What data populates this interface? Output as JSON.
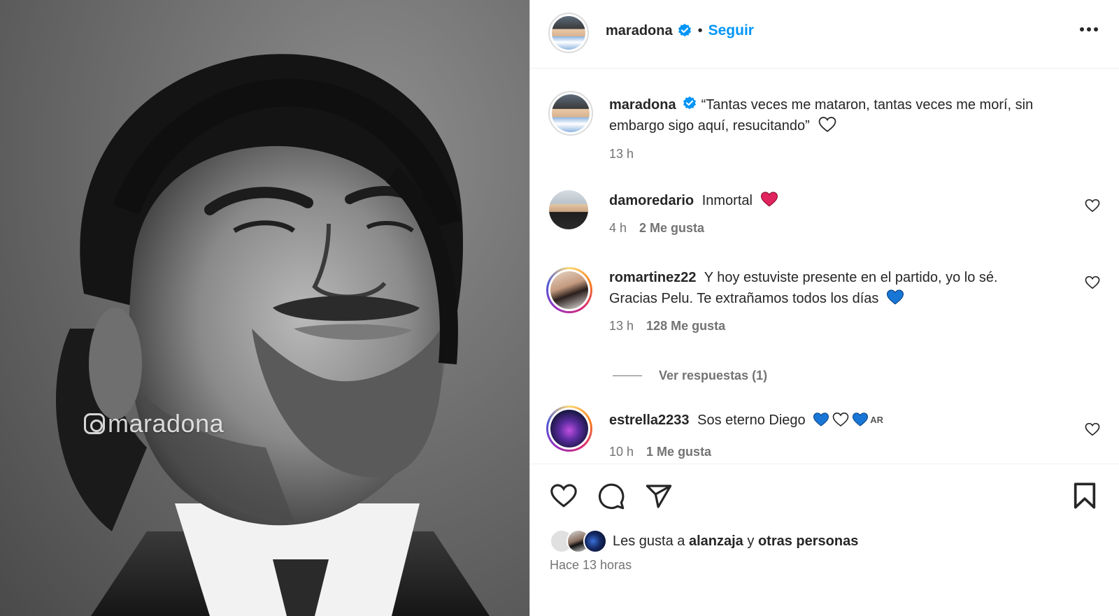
{
  "post": {
    "watermark": "maradona",
    "author": "maradona",
    "follow_label": "Seguir",
    "separator": "•"
  },
  "caption": {
    "username": "maradona",
    "line1": "“Tantas veces me mataron, tantas veces me morí, sin",
    "line2": "embargo sigo aquí, resucitando”",
    "time": "13 h"
  },
  "comments": [
    {
      "username": "damoredario",
      "line1": "Inmortal",
      "line2": "",
      "emojis": [
        "red-heart"
      ],
      "time": "4 h",
      "likes": "2 Me gusta"
    },
    {
      "username": "romartinez22",
      "line1": "Y hoy estuviste presente en el partido, yo lo sé.",
      "line2": "Gracias Pelu. Te extrañamos todos los días",
      "emojis": [
        "blue-heart"
      ],
      "time": "13 h",
      "likes": "128 Me gusta",
      "replies": "Ver respuestas (1)"
    },
    {
      "username": "estrella2233",
      "line1": "Sos eterno Diego",
      "line2": "",
      "emojis": [
        "blue-heart",
        "white-heart",
        "blue-heart"
      ],
      "flag_text": "AR",
      "time": "10 h",
      "likes": "1 Me gusta"
    }
  ],
  "likes_summary": {
    "prefix": "Les gusta a",
    "user": "alanzaja",
    "connector": "y",
    "others": "otras personas"
  },
  "timestamp": "Hace 13 horas",
  "colors": {
    "link": "#0095f6",
    "verified": "#0095f6",
    "text": "#262626",
    "muted": "#737373",
    "red_heart": "#e0245e",
    "blue_heart": "#1877d6"
  }
}
